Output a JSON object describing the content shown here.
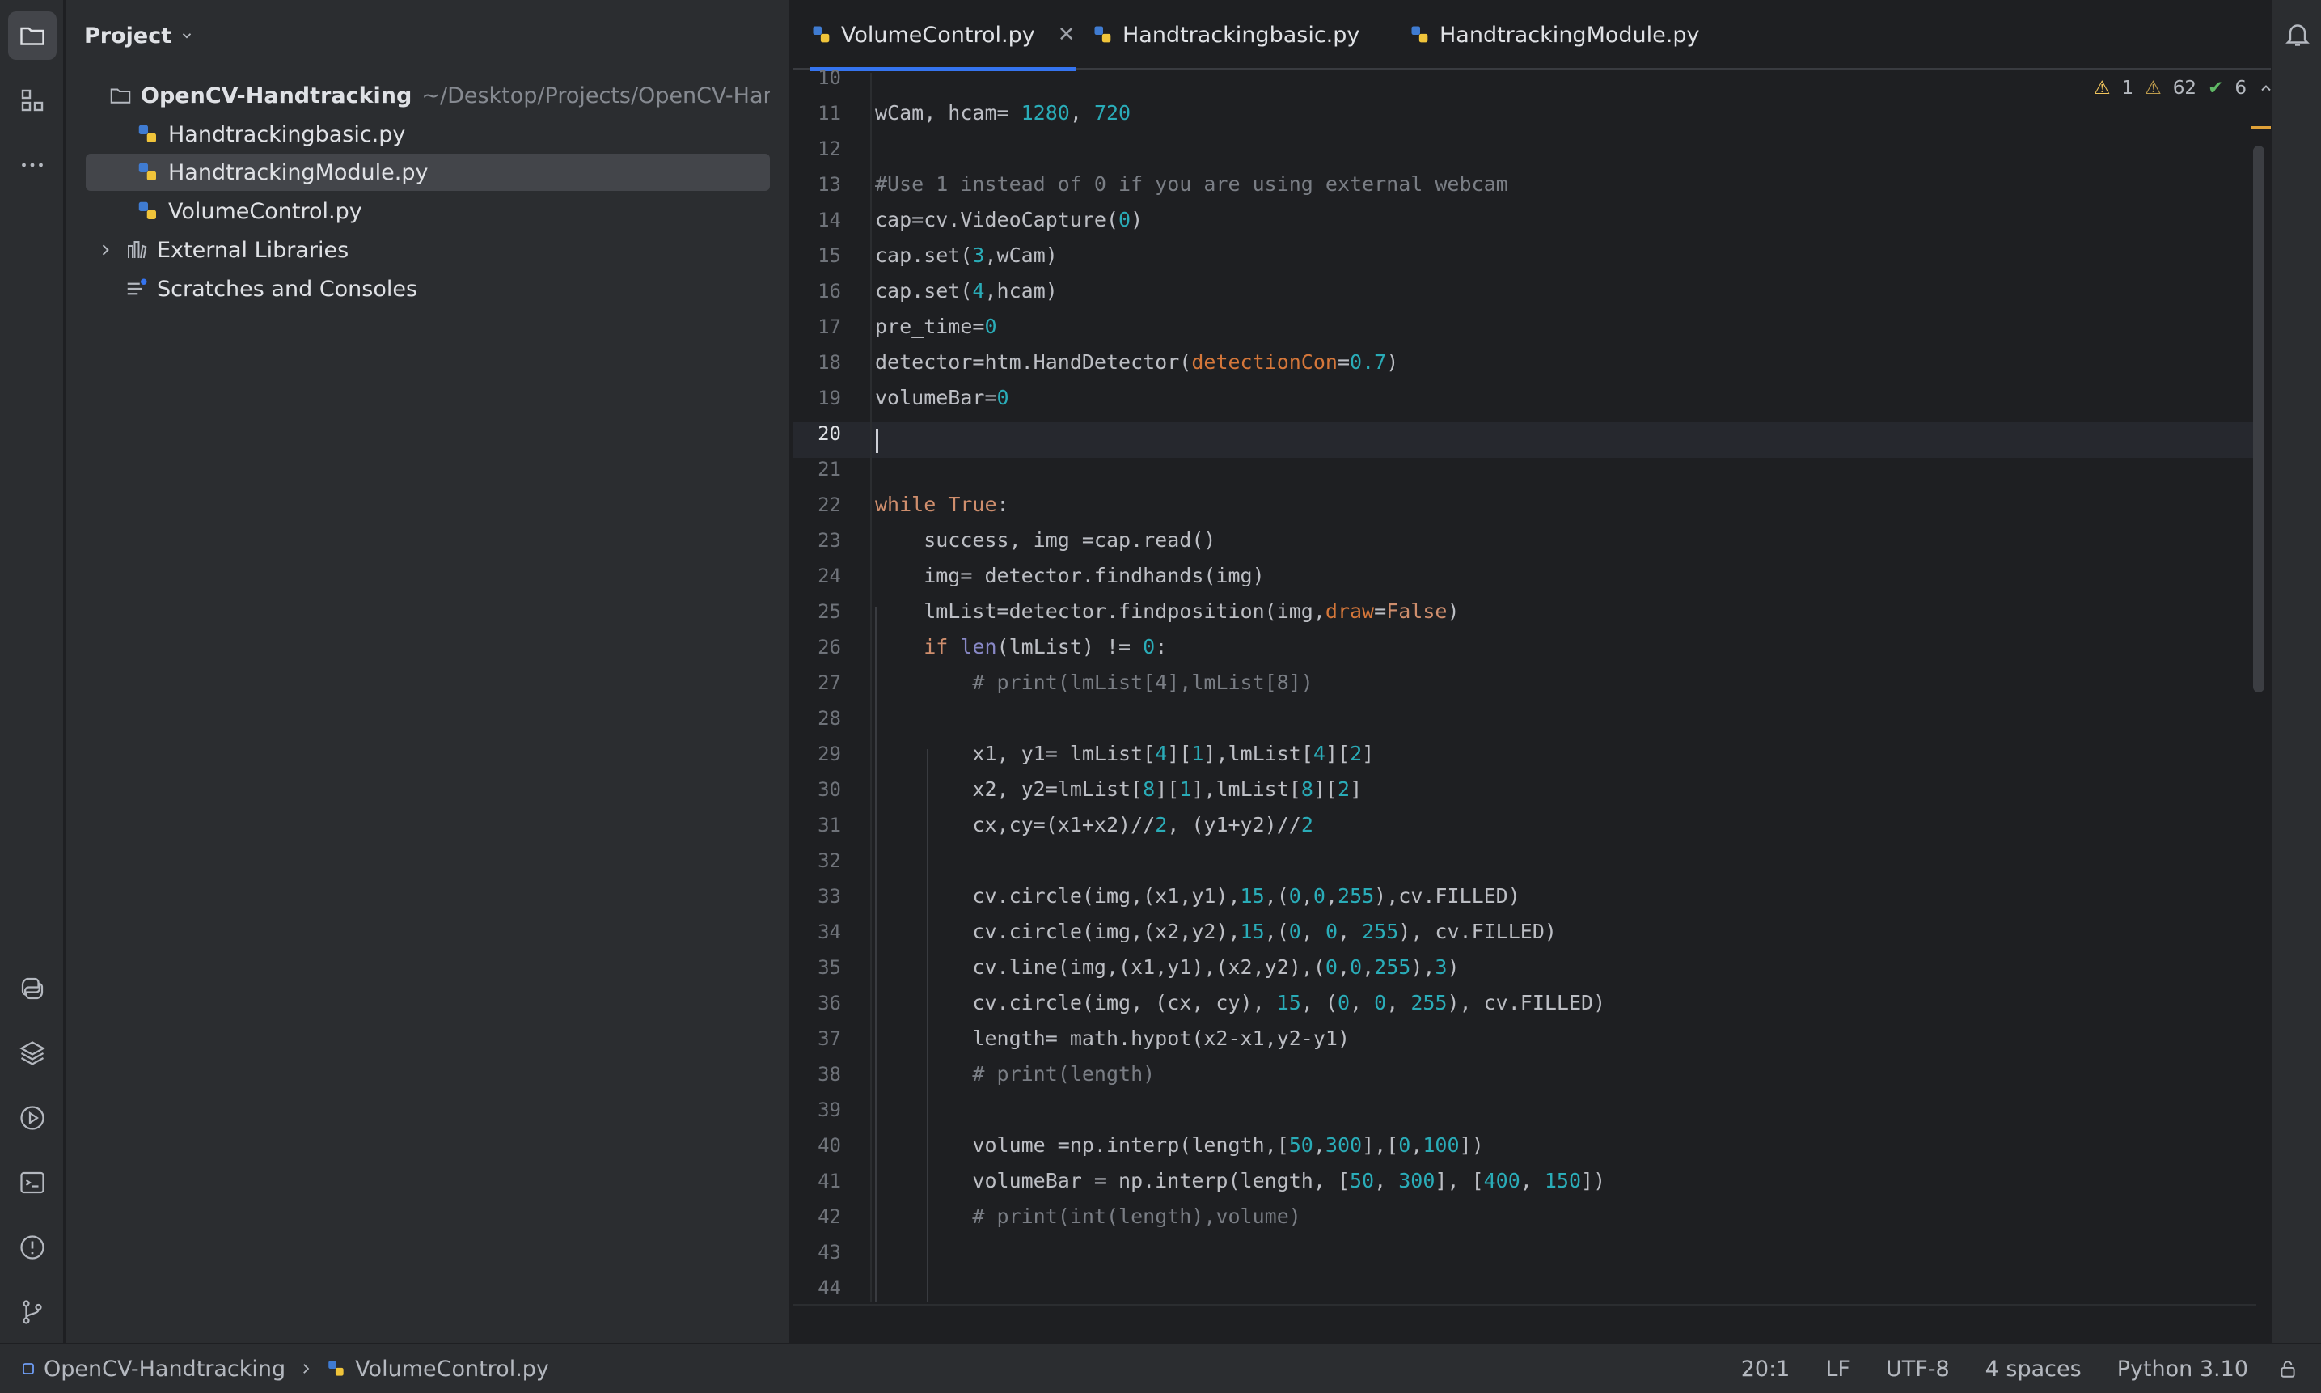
{
  "project_panel": {
    "title": "Project",
    "root": {
      "name": "OpenCV-Handtracking",
      "path": "~/Desktop/Projects/OpenCV-Handtrack"
    },
    "files": [
      "Handtrackingbasic.py",
      "HandtrackingModule.py",
      "VolumeControl.py"
    ],
    "external": "External Libraries",
    "scratches": "Scratches and Consoles"
  },
  "tabs": [
    {
      "label": "VolumeControl.py",
      "active": true
    },
    {
      "label": "Handtrackingbasic.py",
      "active": false
    },
    {
      "label": "HandtrackingModule.py",
      "active": false
    }
  ],
  "inspection": {
    "warnings": "1",
    "weak_warnings": "62",
    "typos": "6"
  },
  "editor": {
    "line_numbers": [
      "10",
      "11",
      "12",
      "13",
      "14",
      "15",
      "16",
      "17",
      "18",
      "19",
      "20",
      "21",
      "22",
      "23",
      "24",
      "25",
      "26",
      "27",
      "28",
      "29",
      "30",
      "31",
      "32",
      "33",
      "34",
      "35",
      "36",
      "37",
      "38",
      "39",
      "40",
      "41",
      "42",
      "43",
      "44"
    ],
    "current_line": "20",
    "lines": [
      "",
      "wCam, hcam= 1280, 720",
      "",
      "#Use 1 instead of 0 if you are using external webcam",
      "cap=cv.VideoCapture(0)",
      "cap.set(3,wCam)",
      "cap.set(4,hcam)",
      "pre_time=0",
      "detector=htm.HandDetector(detectionCon=0.7)",
      "volumeBar=0",
      "",
      "",
      "while True:",
      "    success, img =cap.read()",
      "    img= detector.findhands(img)",
      "    lmList=detector.findposition(img,draw=False)",
      "    if len(lmList) != 0:",
      "        # print(lmList[4],lmList[8])",
      "",
      "        x1, y1= lmList[4][1],lmList[4][2]",
      "        x2, y2=lmList[8][1],lmList[8][2]",
      "        cx,cy=(x1+x2)//2, (y1+y2)//2",
      "",
      "        cv.circle(img,(x1,y1),15,(0,0,255),cv.FILLED)",
      "        cv.circle(img,(x2,y2),15,(0, 0, 255), cv.FILLED)",
      "        cv.line(img,(x1,y1),(x2,y2),(0,0,255),3)",
      "        cv.circle(img, (cx, cy), 15, (0, 0, 255), cv.FILLED)",
      "        length= math.hypot(x2-x1,y2-y1)",
      "        # print(length)",
      "",
      "        volume =np.interp(length,[50,300],[0,100])",
      "        volumeBar = np.interp(length, [50, 300], [400, 150])",
      "        # print(int(length),volume)",
      "",
      ""
    ]
  },
  "status_bar": {
    "breadcrumb": [
      "OpenCV-Handtracking",
      "VolumeControl.py"
    ],
    "position": "20:1",
    "line_sep": "LF",
    "encoding": "UTF-8",
    "indent": "4 spaces",
    "interpreter": "Python 3.10"
  },
  "colors": {
    "accent": "#3574f0",
    "keyword": "#cf8e6d",
    "number": "#2aacb8",
    "comment": "#7a7e85",
    "param": "#d5773a"
  }
}
